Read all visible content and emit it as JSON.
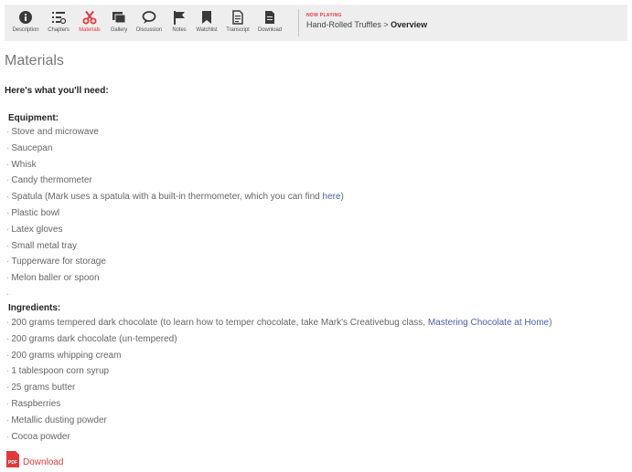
{
  "toolbar": {
    "items": [
      {
        "label": "Description",
        "icon": "info-icon",
        "active": false
      },
      {
        "label": "Chapters",
        "icon": "chapters-list-icon",
        "active": false
      },
      {
        "label": "Materials",
        "icon": "scissors-icon",
        "active": true
      },
      {
        "label": "Gallery",
        "icon": "gallery-icon",
        "active": false
      },
      {
        "label": "Discussion",
        "icon": "chat-bubble-icon",
        "active": false
      },
      {
        "label": "Notes",
        "icon": "flag-icon",
        "active": false
      },
      {
        "label": "Watchlist",
        "icon": "bookmark-icon",
        "active": false
      },
      {
        "label": "Transcript",
        "icon": "transcript-icon",
        "active": false
      },
      {
        "label": "Download",
        "icon": "download-file-icon",
        "active": false
      }
    ],
    "now_playing_label": "NOW PLAYING",
    "now_playing_course": "Hand-Rolled Truffles",
    "now_playing_separator": " > ",
    "now_playing_chapter": "Overview"
  },
  "colors": {
    "accent": "#e0393e",
    "link": "#4a5fa8",
    "toolbar_bg": "#eeeeee"
  },
  "page": {
    "heading": "Materials",
    "intro": "Here's what you'll need:",
    "equipment_title": "Equipment:",
    "equipment": [
      "Stove and microwave",
      "Saucepan",
      "Whisk",
      "Candy thermometer",
      "Spatula (Mark uses a spatula with a built-in thermometer, which you can find ",
      "Plastic bowl",
      "Latex gloves",
      "Small metal tray",
      "Tupperware for storage",
      "Melon baller or spoon"
    ],
    "spatula_link": "here",
    "spatula_close": ")",
    "ingredients_title": "Ingredients:",
    "ingredients": [
      "200 grams tempered dark chocolate (to learn how to temper chocolate, take Mark's Creativebug class, ",
      "200 grams dark chocolate (un-tempered)",
      "200 grams whipping cream",
      "1 tablespoon corn syrup",
      "25 grams butter",
      "Raspberries",
      "Metallic dusting powder",
      "Cocoa powder"
    ],
    "chocolate_link": "Mastering Chocolate at Home",
    "chocolate_close": ")",
    "pdf_badge": "PDF",
    "download_label": "Download"
  }
}
